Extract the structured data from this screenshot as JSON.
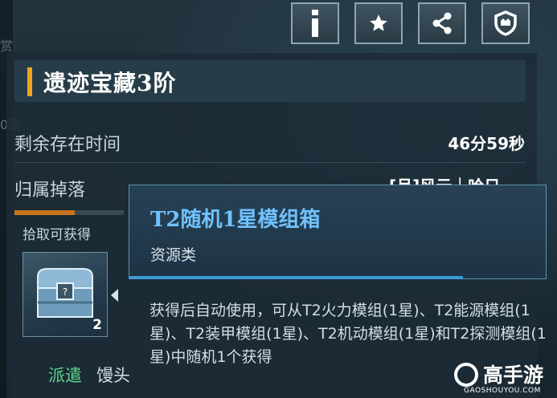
{
  "toolbar": {
    "buttons": [
      {
        "name": "info-button",
        "icon": "info-icon"
      },
      {
        "name": "favorite-button",
        "icon": "star-icon"
      },
      {
        "name": "share-button",
        "icon": "share-icon"
      },
      {
        "name": "guild-button",
        "icon": "shield-icon"
      }
    ]
  },
  "background_fragments": {
    "top": "赏",
    "middle": "0层"
  },
  "header": {
    "title": "遗迹宝藏3阶",
    "accent_color": "#f0a51c"
  },
  "info_rows": {
    "remaining_time_label": "剩余存在时间",
    "remaining_time_value": "46分59秒",
    "owner_drop_label": "归属掉落",
    "owner_drop_value": "[月]风云｜哈日"
  },
  "loot": {
    "title": "拾取可获得",
    "item_icon": "treasure-chest-icon",
    "item_count": "2",
    "progress": 0.55
  },
  "bottom": {
    "dispatch_label": "派遣",
    "unit_name": "馒头"
  },
  "tooltip": {
    "title": "T2随机1星模组箱",
    "type": "资源类",
    "title_color": "#6fc2ff",
    "description": "获得后自动使用，可从T2火力模组(1星)、T2能源模组(1星)、T2装甲模组(1星)、T2机动模组(1星)和T2探测模组(1星)中随机1个获得"
  },
  "watermark": {
    "text": "高手游",
    "url": "GAOSHOUYOU.COM"
  }
}
